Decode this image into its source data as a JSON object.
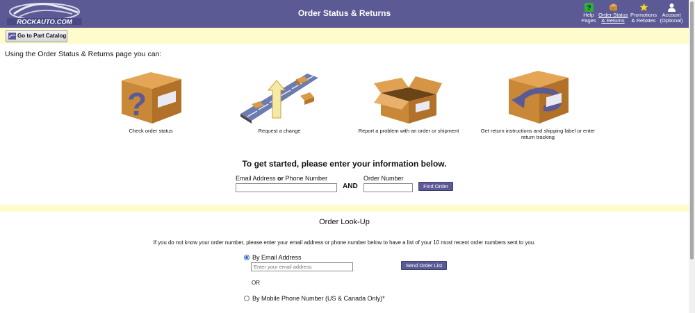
{
  "header": {
    "logo_text": "ROCKAUTO.COM",
    "title": "Order Status & Returns",
    "nav": [
      {
        "label": "Help\nPages",
        "icon": "help-icon"
      },
      {
        "label": "Order Status\n& Returns",
        "icon": "box-icon"
      },
      {
        "label": "Promotions\n& Rebates",
        "icon": "star-icon"
      },
      {
        "label": "Account\n(Optional)",
        "icon": "user-icon"
      }
    ]
  },
  "catalog_button": "Go to Part Catalog",
  "intro": "Using the Order Status & Returns page you can:",
  "features": [
    {
      "caption": "Check order status",
      "icon": "question-box-icon"
    },
    {
      "caption": "Request a change",
      "icon": "conveyor-arrow-icon"
    },
    {
      "caption": "Report a problem with an order or shipment",
      "icon": "open-box-icon"
    },
    {
      "caption": "Get return instructions and shipping label or enter return tracking",
      "icon": "return-box-icon"
    }
  ],
  "get_started": "To get started, please enter your information below.",
  "find_form": {
    "email_label_1": "Email Address ",
    "email_label_or": "or",
    "email_label_2": " Phone Number",
    "and": "AND",
    "order_label": "Order Number",
    "button": "Find Order"
  },
  "lookup": {
    "title": "Order Look-Up",
    "description": "If you do not know your order number, please enter your email address or phone number below to have a list of your 10 most recent order numbers sent to you.",
    "by_email": "By Email Address",
    "email_placeholder": "Enter your email address",
    "send_button": "Send Order List",
    "or": "OR",
    "by_phone": "By Mobile Phone Number (US & Canada Only)*"
  },
  "colors": {
    "header": "#5b5a95",
    "bar": "#fffccc",
    "accent": "#2a66c8"
  }
}
